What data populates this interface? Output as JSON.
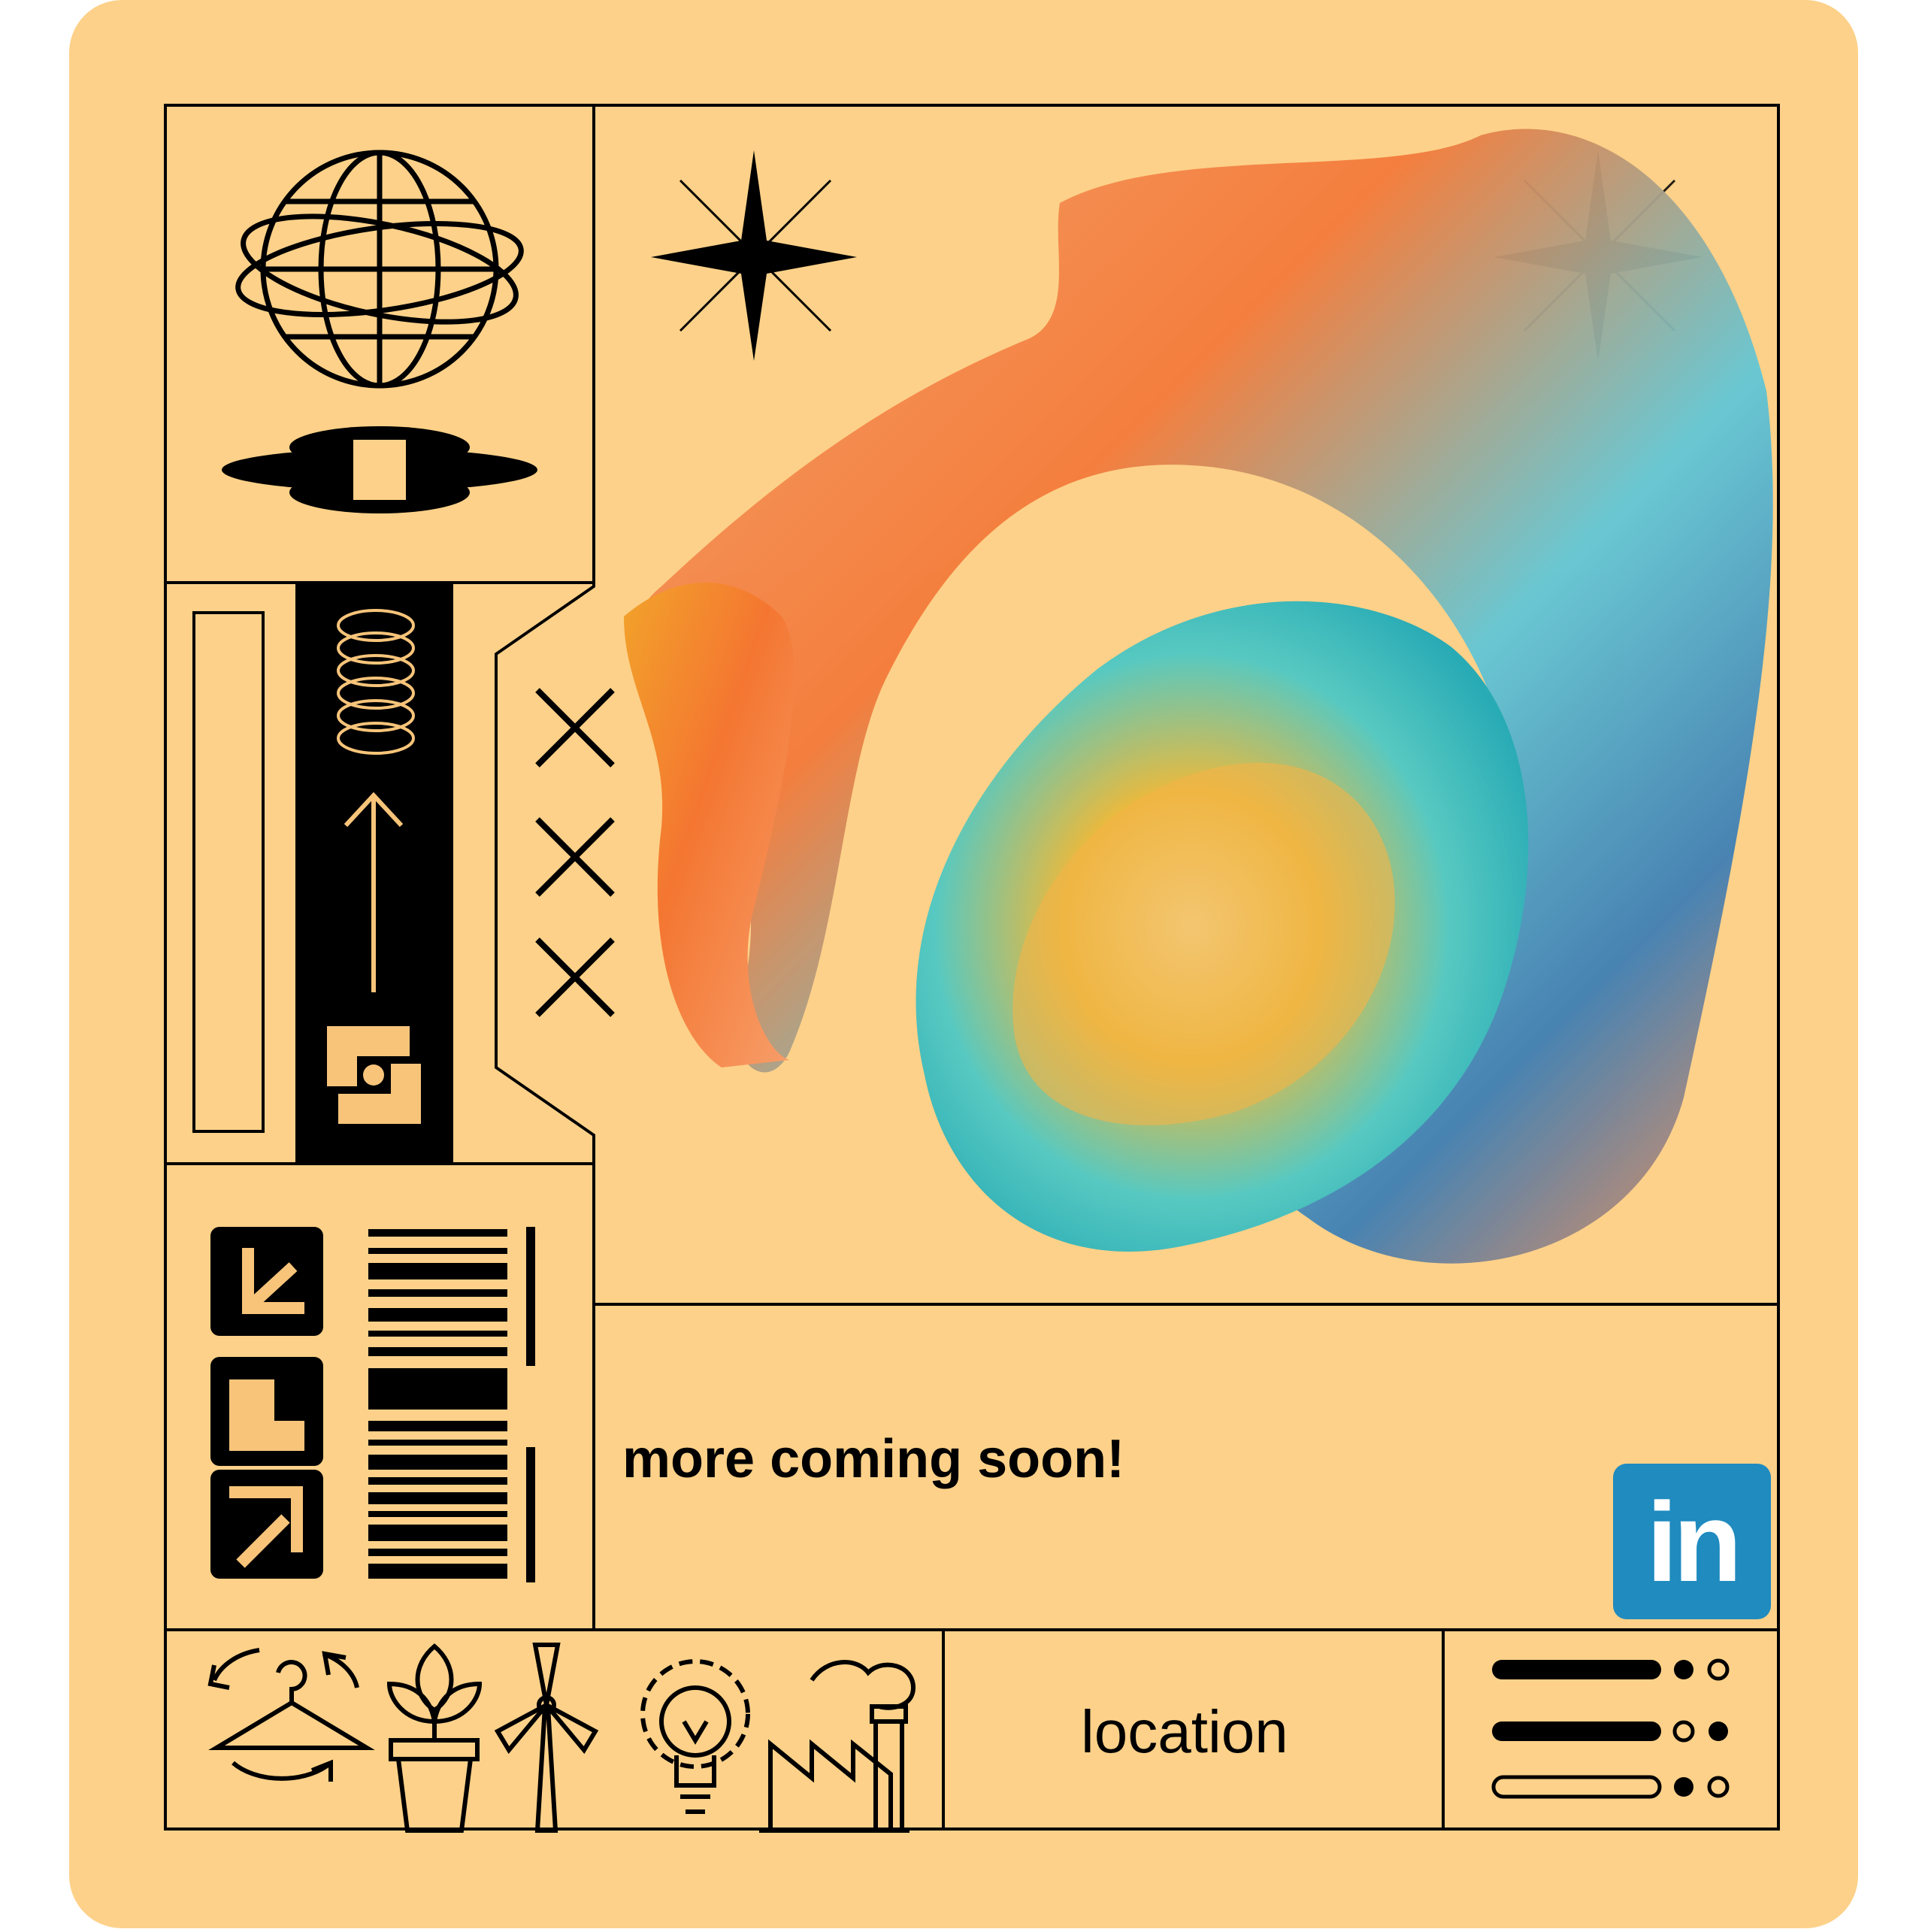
{
  "headline": "more coming soon!",
  "location_label": "location",
  "social": {
    "linkedin_text": "in"
  },
  "icons": {
    "top_left": [
      "globe-orbit-icon",
      "four-petal-ellipse-icon"
    ],
    "middle_left": [
      "spring-coil-icon",
      "arrow-up-icon",
      "swirl-s-icon"
    ],
    "cross_marks": [
      "cross-icon",
      "cross-icon",
      "cross-icon"
    ],
    "square_tiles": [
      "diagonal-arrow-tile-icon",
      "step-tile-icon",
      "corner-arrow-tile-icon"
    ],
    "bottom_row": [
      "hanger-recycle-icon",
      "plant-pot-icon",
      "wind-turbine-icon",
      "bulb-gear-icon",
      "factory-icon"
    ],
    "sparkles": [
      "sparkle-star-icon",
      "sparkle-star-icon"
    ],
    "menu": "menu-toggle-icon"
  },
  "colors": {
    "background": "#fdd189",
    "ink": "#000000",
    "linkedin": "#1f8bbf",
    "tile_inner": "#f7c47a"
  }
}
